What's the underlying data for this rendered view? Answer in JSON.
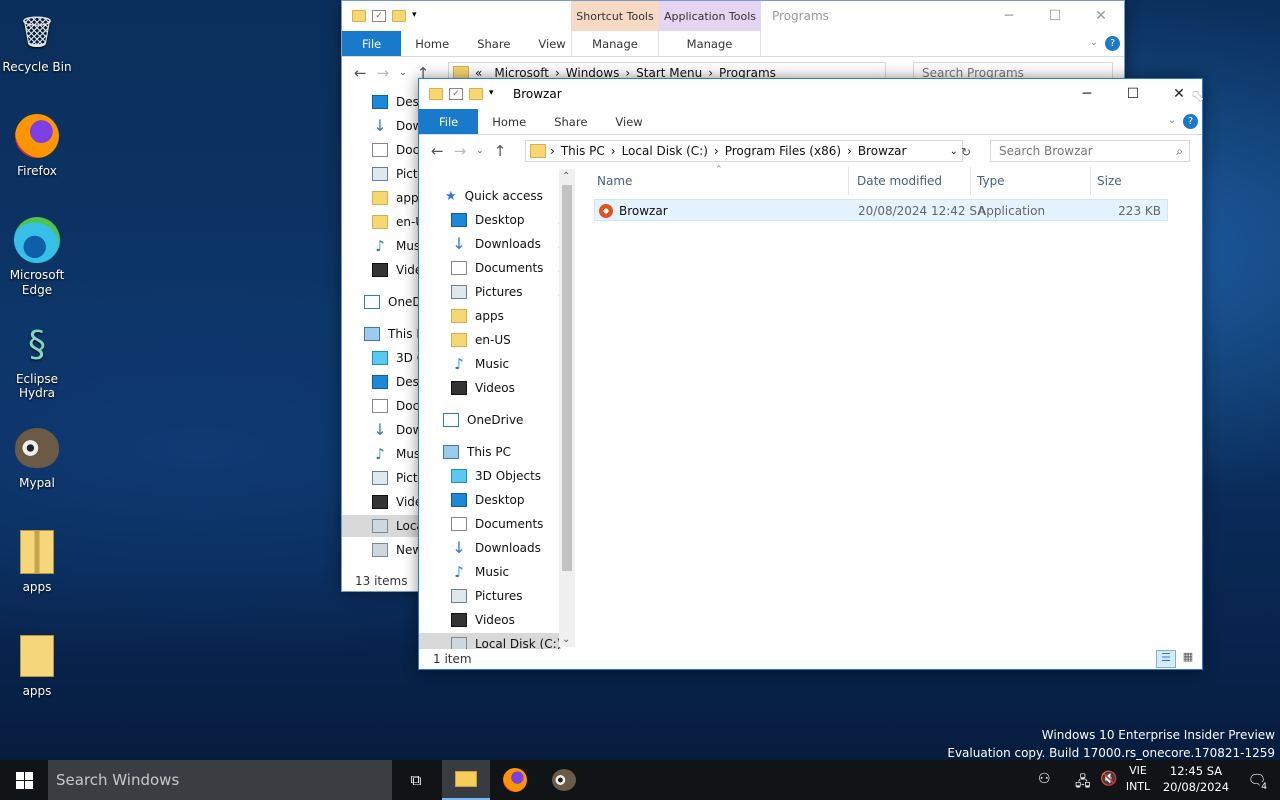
{
  "desktop_icons": [
    {
      "label": "Recycle Bin",
      "icon": "recycle-bin-icon"
    },
    {
      "label": "Firefox",
      "icon": "firefox-icon"
    },
    {
      "label": "Microsoft Edge",
      "icon": "edge-icon"
    },
    {
      "label": "Eclipse Hydra",
      "icon": "hydra-icon"
    },
    {
      "label": "Mypal",
      "icon": "mypal-icon"
    },
    {
      "label": "apps",
      "icon": "zip-folder-icon"
    },
    {
      "label": "apps",
      "icon": "folder-icon"
    }
  ],
  "back_window": {
    "title": "Programs",
    "context_tabs": [
      "Shortcut Tools",
      "Application Tools"
    ],
    "tabs": [
      "File",
      "Home",
      "Share",
      "View"
    ],
    "manage": [
      "Manage",
      "Manage"
    ],
    "path": [
      "«",
      "Microsoft",
      "Windows",
      "Start Menu",
      "Programs"
    ],
    "search_placeholder": "Search Programs",
    "nav_items": [
      "Desk",
      "Dow",
      "Docu",
      "Pictu",
      "apps",
      "en-U",
      "Mus",
      "Vide",
      "OneDri",
      "This P",
      "3D O",
      "Desk",
      "Docu",
      "Dow",
      "Mus",
      "Pictu",
      "Vide",
      "Loca",
      "New"
    ],
    "status": "13 items"
  },
  "front_window": {
    "title": "Browzar",
    "tabs": [
      "File",
      "Home",
      "Share",
      "View"
    ],
    "path": [
      "This PC",
      "Local Disk (C:)",
      "Program Files (x86)",
      "Browzar"
    ],
    "search_placeholder": "Search Browzar",
    "quick_access": "Quick access",
    "quick_items": [
      "Desktop",
      "Downloads",
      "Documents",
      "Pictures",
      "apps",
      "en-US",
      "Music",
      "Videos"
    ],
    "onedrive": "OneDrive",
    "this_pc": "This PC",
    "pc_items": [
      "3D Objects",
      "Desktop",
      "Documents",
      "Downloads",
      "Music",
      "Pictures",
      "Videos",
      "Local Disk (C:)"
    ],
    "columns": [
      "Name",
      "Date modified",
      "Type",
      "Size"
    ],
    "files": [
      {
        "name": "Browzar",
        "date": "20/08/2024 12:42 SA",
        "type": "Application",
        "size": "223 KB"
      }
    ],
    "status": "1 item"
  },
  "watermark": {
    "line1": "Windows 10 Enterprise Insider Preview",
    "line2": "Evaluation copy. Build 17000.rs_onecore.170821-1259"
  },
  "taskbar": {
    "search_placeholder": "Search Windows",
    "lang_top": "VIE",
    "lang_bottom": "INTL",
    "time": "12:45 SA",
    "date": "20/08/2024",
    "notifications": "4"
  }
}
